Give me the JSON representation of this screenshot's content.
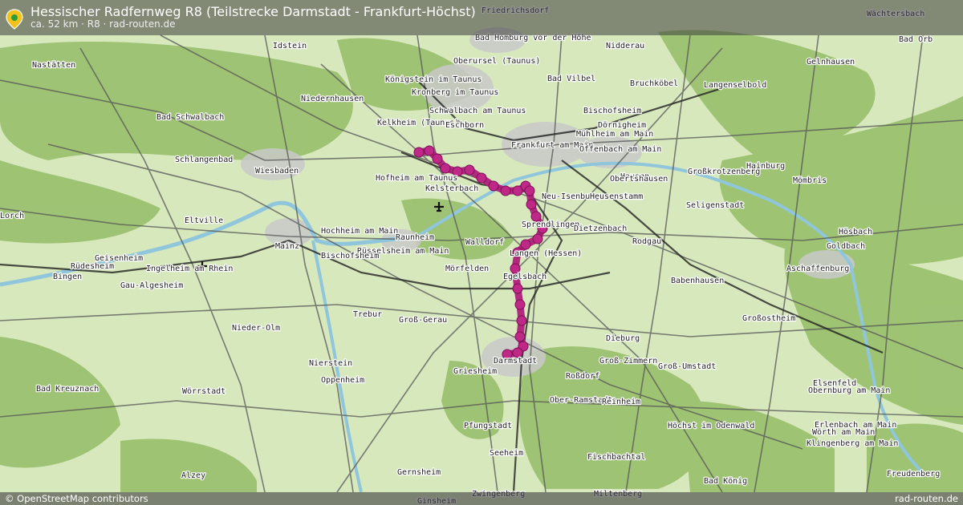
{
  "header": {
    "title": "Hessischer Radfernweg R8 (Teilstrecke Darmstadt - Frankfurt-Höchst)",
    "subtitle": "ca. 52 km · R8 · rad-routen.de"
  },
  "footer": {
    "attribution": "© OpenStreetMap contributors",
    "brand": "rad-routen.de"
  },
  "colors": {
    "route": "#b0207a",
    "forest": "#9cc070",
    "farmland": "#e6efc4",
    "urban": "#d4d4d4",
    "water": "#aad3df"
  },
  "places": [
    "Friedrichsdorf",
    "Wächtersbach",
    "Idstein",
    "Bad Homburg vor der Höhe",
    "Nidderau",
    "Bad Orb",
    "Nastätten",
    "Oberursel (Taunus)",
    "Gelnhausen",
    "Königstein im Taunus",
    "Bad Vilbel",
    "Bruchköbel",
    "Langenselbold",
    "Niedernhausen",
    "Kronberg im Taunus",
    "Bad Schwalbach",
    "Schwalbach am Taunus",
    "Bischofsheim",
    "Kelkheim (Taunus)",
    "Eschborn",
    "Dörnigheim",
    "Mühlheim am Main",
    "Schlangenbad",
    "Frankfurt am Main",
    "Offenbach am Main",
    "Wiesbaden",
    "Hofheim am Taunus",
    "Hausen",
    "Obertshausen",
    "Großkrotzenberg",
    "Hainburg",
    "Kelsterbach",
    "Neu-Isenburg",
    "Heusenstamm",
    "Mömbris",
    "Seligenstadt",
    "Lorch",
    "Eltville",
    "Sprendlingen",
    "Dietzenbach",
    "Hochheim am Main",
    "Raunheim",
    "Walldorf",
    "Rodgau",
    "Hösbach",
    "Goldbach",
    "Mainz",
    "Rüsselsheim am Main",
    "Langen (Hessen)",
    "Geisenheim",
    "Rüdesheim",
    "Ingelheim am Rhein",
    "Bischofsheim",
    "Mörfelden",
    "Aschaffenburg",
    "Bingen",
    "Gau-Algesheim",
    "Egelsbach",
    "Babenhausen",
    "Trebur",
    "Groß-Gerau",
    "Großostheim",
    "Nieder-Olm",
    "Dieburg",
    "Groß-Zimmern",
    "Nierstein",
    "Groß-Umstadt",
    "Darmstadt",
    "Griesheim",
    "Roßdorf",
    "Oppenheim",
    "Elsenfeld",
    "Obernburg am Main",
    "Bad Kreuznach",
    "Wörrstadt",
    "Ober-Ramstadt",
    "Reinheim",
    "Pfungstadt",
    "Höchst im Odenwald",
    "Erlenbach am Main",
    "Wörth am Main",
    "Klingenberg am Main",
    "Seeheim",
    "Fischbachtal",
    "Gernsheim",
    "Alzey",
    "Freudenberg",
    "Bad König",
    "Zwingenberg",
    "Miltenberg",
    "Ginsheim"
  ],
  "map_features": {
    "airport-icon": "airplane",
    "location-pin-icon": "location-pin"
  }
}
